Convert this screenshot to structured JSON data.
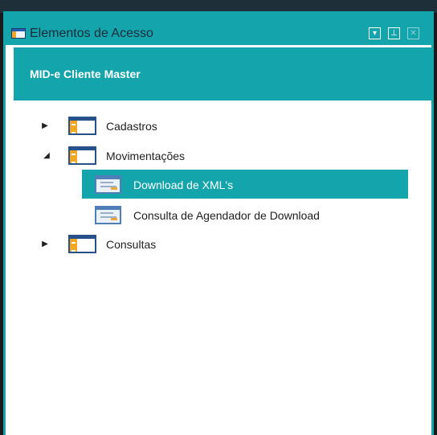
{
  "window": {
    "title": "Elementos de Acesso",
    "buttons": [
      {
        "icon": "dropdown-icon",
        "glyph": "▾"
      },
      {
        "icon": "pin-icon",
        "glyph": "⊥"
      },
      {
        "icon": "close-icon",
        "glyph": "✕"
      }
    ],
    "accent_color": "#14a4ab"
  },
  "header": {
    "text": "MID-e Cliente Master"
  },
  "tree": {
    "items": [
      {
        "label": "Cadastros",
        "expanded": false,
        "icon": "folder-icon"
      },
      {
        "label": "Movimentações",
        "expanded": true,
        "icon": "folder-icon",
        "children": [
          {
            "label": "Download de XML's",
            "selected": true,
            "icon": "document-icon"
          },
          {
            "label": "Consulta de Agendador de Download",
            "selected": false,
            "icon": "document-icon"
          }
        ]
      },
      {
        "label": "Consultas",
        "expanded": false,
        "icon": "folder-icon"
      }
    ],
    "arrows": {
      "collapsed": "▶",
      "expanded": "◢"
    }
  }
}
